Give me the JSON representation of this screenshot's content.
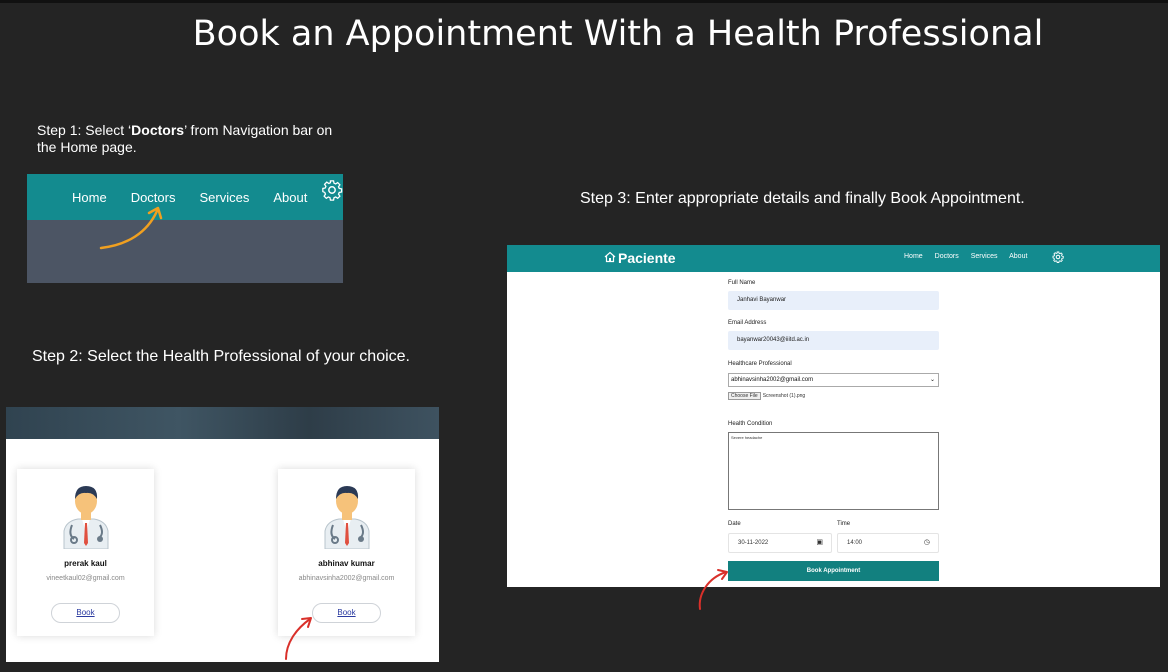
{
  "page": {
    "title": "Book an Appointment With a Health Professional"
  },
  "step1": {
    "text_prefix": "Step 1: Select ‘",
    "text_bold": "Doctors",
    "text_suffix": "’ from Navigation bar on the Home page.",
    "nav": [
      "Home",
      "Doctors",
      "Services",
      "About"
    ],
    "gear_icon": "gear-icon"
  },
  "step2": {
    "text": "Step 2: Select the Health Professional of your choice.",
    "doctors": [
      {
        "name": "prerak kaul",
        "email": "vineetkaul02@gmail.com",
        "book_label": "Book"
      },
      {
        "name": "abhinav kumar",
        "email": "abhinavsinha2002@gmail.com",
        "book_label": "Book"
      }
    ]
  },
  "step3": {
    "text": "Step 3: Enter appropriate details and finally Book Appointment.",
    "brand": "Paciente",
    "nav": [
      "Home",
      "Doctors",
      "Services",
      "About"
    ],
    "form": {
      "full_name_label": "Full Name",
      "full_name_value": "Janhavi Bayanwar",
      "email_label": "Email Address",
      "email_value": "bayanwar20043@iiitd.ac.in",
      "professional_label": "Healthcare Professional",
      "professional_value": "abhinavsinha2002@gmail.com",
      "file_button": "Choose File",
      "file_name": "Screenshot (1).png",
      "condition_label": "Health Condition",
      "condition_value": "Severe headache",
      "date_label": "Date",
      "date_value": "30-11-2022",
      "time_label": "Time",
      "time_value": "14:00",
      "submit_label": "Book Appointment"
    }
  },
  "colors": {
    "background": "#242424",
    "teal": "#138b8f",
    "arrow_orange": "#f0a020",
    "arrow_red": "#d9302a"
  }
}
